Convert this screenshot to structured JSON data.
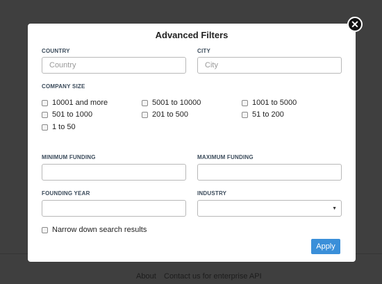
{
  "modal": {
    "title": "Advanced Filters",
    "country": {
      "label": "COUNTRY",
      "placeholder": "Country",
      "value": ""
    },
    "city": {
      "label": "CITY",
      "placeholder": "City",
      "value": ""
    },
    "company_size": {
      "label": "COMPANY SIZE",
      "options": [
        "10001 and more",
        "5001 to 10000",
        "1001 to 5000",
        "501 to 1000",
        "201 to 500",
        "51 to 200",
        "1 to 50"
      ]
    },
    "min_funding": {
      "label": "MINIMUM FUNDING",
      "value": ""
    },
    "max_funding": {
      "label": "MAXIMUM FUNDING",
      "value": ""
    },
    "founding_year": {
      "label": "FOUNDING YEAR",
      "value": ""
    },
    "industry": {
      "label": "INDUSTRY",
      "selected": ""
    },
    "narrow_label": "Narrow down search results",
    "apply_label": "Apply"
  },
  "close_icon": "close-icon",
  "footer": {
    "about": "About",
    "api": "Contact us for enterprise API"
  }
}
